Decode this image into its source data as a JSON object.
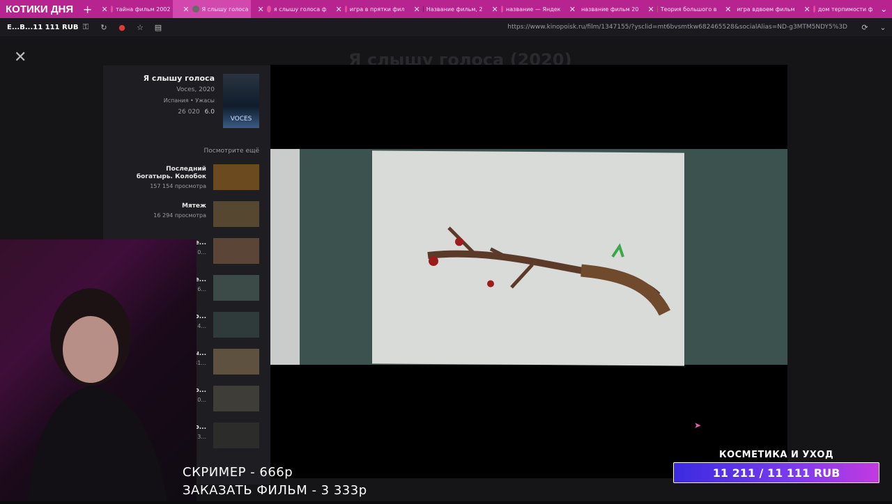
{
  "stream": {
    "title": "КОТИКИ ДНЯ",
    "wallet": "E...B...11 111 RUB",
    "promo": [
      "СКРИМЕР - 666р",
      "ЗАКАЗАТЬ ФИЛЬМ - 3 333р"
    ],
    "goal": {
      "label": "КОСМЕТИКА И УХОД",
      "value": "11 211 / 11 111 RUB",
      "progress": 1.0
    }
  },
  "tabs": [
    {
      "label": "тайна фильм 2002",
      "favicon": "#e84d9a"
    },
    {
      "label": "Я слышу голоса",
      "favicon": "#6a6a6a",
      "active": true
    },
    {
      "label": "я слышу голоса ф",
      "favicon": "#e84d9a"
    },
    {
      "label": "игра в прятки фил",
      "favicon": "#e84d9a"
    },
    {
      "label": "Название фильм, 2",
      "favicon": "#3a3a3a"
    },
    {
      "label": "название — Яндек",
      "favicon": "#e84d9a"
    },
    {
      "label": "название фильм 20",
      "favicon": "#e84d9a"
    },
    {
      "label": "Теория большого в",
      "favicon": "#6b8d3a"
    },
    {
      "label": "игра вдвоем фильм",
      "favicon": "#e84d9a"
    },
    {
      "label": "дом терпимости ф",
      "favicon": "#e84d9a"
    }
  ],
  "addressbar": {
    "url": "https://www.kinopoisk.ru/film/1347155/?ysclid=mt6bvsmtkw682465528&socialAlias=ND-g3MTM5NDY5%3D"
  },
  "page": {
    "bg_title": "Я слышу голоса (2020)"
  },
  "movie": {
    "title": "Я слышу голоса",
    "subtitle": "Voces, 2020",
    "genre": "Испания • Ужасы",
    "rating": "6.0",
    "votes": "26 020",
    "poster_text": "VOCES"
  },
  "recommendations": {
    "section_title": "Посмотрите ещё",
    "items": [
      {
        "title": "Последний богатырь. Колобок",
        "views": "157 154 просмотра",
        "thumb": "#6b4a20"
      },
      {
        "title": "Мятеж",
        "views": "16 294 просмотра",
        "thumb": "#564730"
      },
      {
        "title": "См... все...",
        "views": "66 0...",
        "thumb": "#5a4536"
      },
      {
        "title": "Же...",
        "views": "8 6...",
        "thumb": "#3d4b48"
      },
      {
        "title": "Мо...",
        "views": "9 4...",
        "thumb": "#2f3a3a"
      },
      {
        "title": "Вы...",
        "views": "1 81...",
        "thumb": "#5f513f"
      },
      {
        "title": "Кр...",
        "views": "24 0...",
        "thumb": "#3e3d37"
      },
      {
        "title": "Мо...",
        "views": "8 3...",
        "thumb": "#2c2c2a"
      }
    ]
  },
  "icons": [
    "close-icon",
    "reload-icon",
    "bookmark-icon",
    "extension-icon",
    "plus-icon"
  ]
}
